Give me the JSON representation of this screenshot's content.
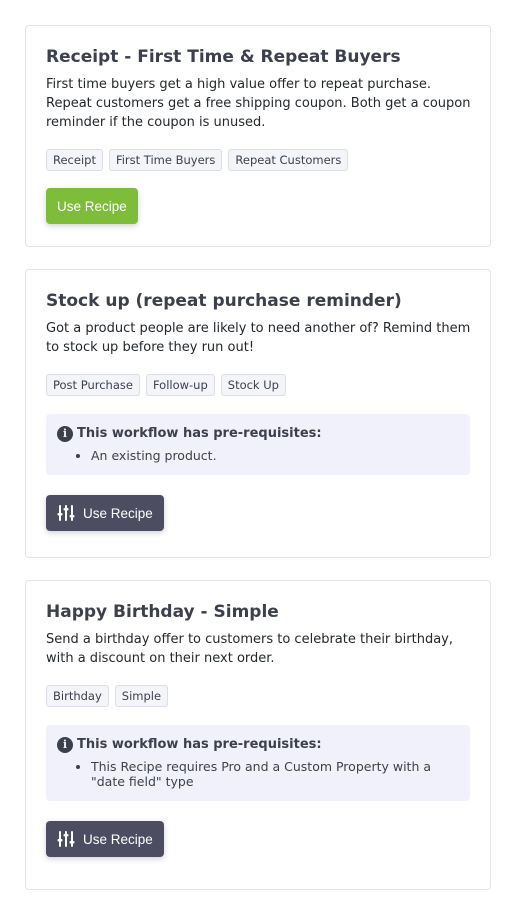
{
  "cards": [
    {
      "title": "Receipt - First Time & Repeat Buyers",
      "description": "First time buyers get a high value offer to repeat purchase. Repeat customers get a free shipping coupon. Both get a coupon reminder if the coupon is unused.",
      "tags": [
        "Receipt",
        "First Time Buyers",
        "Repeat Customers"
      ],
      "button_label": "Use Recipe"
    },
    {
      "title": "Stock up (repeat purchase reminder)",
      "description": "Got a product people are likely to need another of? Remind them to stock up before they run out!",
      "tags": [
        "Post Purchase",
        "Follow-up",
        "Stock Up"
      ],
      "prereq_title": "This workflow has pre-requisites:",
      "prereq_items": [
        "An existing product."
      ],
      "button_label": "Use Recipe"
    },
    {
      "title": "Happy Birthday - Simple",
      "description": "Send a birthday offer to customers to celebrate their birthday, with a discount on their next order.",
      "tags": [
        "Birthday",
        "Simple"
      ],
      "prereq_title": "This workflow has pre-requisites:",
      "prereq_items": [
        "This Recipe requires Pro and a Custom Property with a \"date field\" type"
      ],
      "button_label": "Use Recipe"
    }
  ],
  "colors": {
    "green_button": "#7dbd3a",
    "dark_button": "#4c4d61",
    "prereq_bg": "#f1f1fc"
  },
  "icons": {
    "info": "info-icon",
    "sliders": "sliders-icon"
  }
}
